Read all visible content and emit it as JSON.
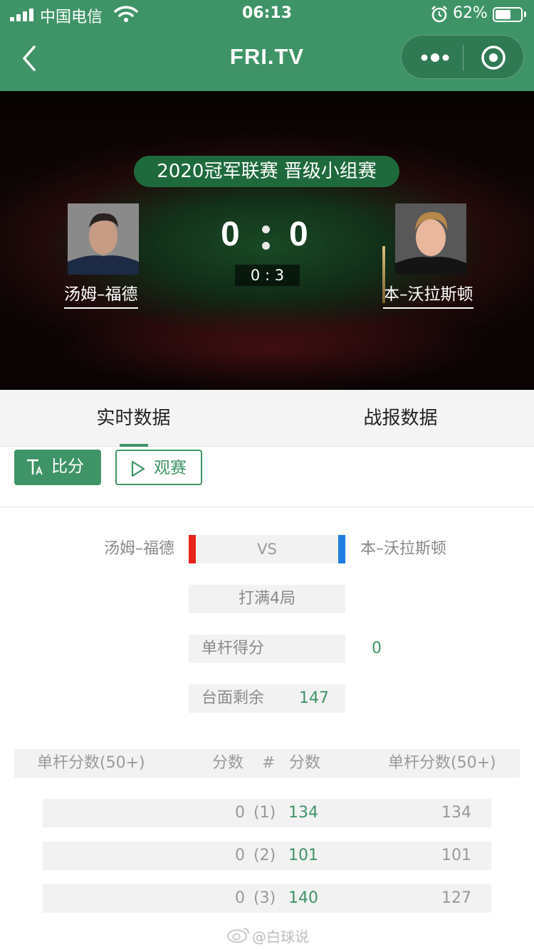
{
  "status_bar": {
    "carrier": "中国电信",
    "time": "06:13",
    "battery_percent": "62%",
    "battery_level": 0.62,
    "icons": [
      "signal-icon",
      "wifi-icon",
      "alarm-icon",
      "battery-icon"
    ]
  },
  "nav": {
    "title": "FRI.TV",
    "icons": [
      "back-arrow-icon",
      "more-dots-icon",
      "target-circle-icon"
    ]
  },
  "hero": {
    "event_title": "2020冠军联赛 晋级小组赛",
    "player_left": "汤姆–福德",
    "player_right": "本–沃拉斯顿",
    "score_left": "0",
    "score_right": "0",
    "frame_score": "0 : 3"
  },
  "tabs": [
    {
      "label": "实时数据",
      "active": true
    },
    {
      "label": "战报数据",
      "active": false
    }
  ],
  "buttons": {
    "score": "比分",
    "watch": "观赛",
    "score_icon": "text-size-icon",
    "watch_icon": "play-outline-icon"
  },
  "match_info": {
    "player_left": "汤姆–福德",
    "player_right": "本–沃拉斯顿",
    "vs": "VS",
    "format": "打满4局",
    "break_label": "单杆得分",
    "break_value": "0",
    "remaining_label": "台面剩余",
    "remaining_value": "147",
    "colors": {
      "left_player": "#e8241c",
      "right_player": "#1f7fe0",
      "accent": "#3f9467"
    }
  },
  "break_table": {
    "headers": {
      "left_breaks": "单杆分数(50+)",
      "left_score": "分数",
      "frame_no": "#",
      "right_score": "分数",
      "right_breaks": "单杆分数(50+)"
    },
    "rows": [
      {
        "left_breaks": "",
        "left_score": "0",
        "frame": "(1)",
        "right_score": "134",
        "right_breaks": "134"
      },
      {
        "left_breaks": "",
        "left_score": "0",
        "frame": "(2)",
        "right_score": "101",
        "right_breaks": "101"
      },
      {
        "left_breaks": "",
        "left_score": "0",
        "frame": "(3)",
        "right_score": "140",
        "right_breaks": "127"
      }
    ]
  },
  "watermark": "@白球说"
}
